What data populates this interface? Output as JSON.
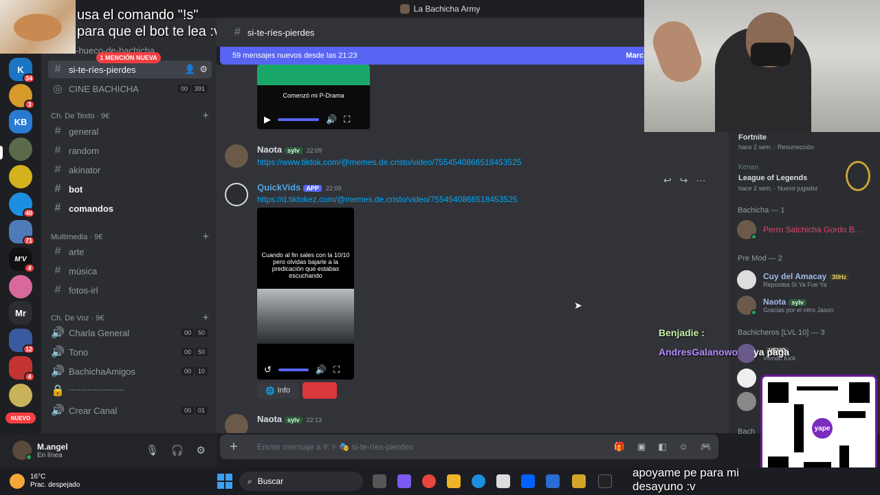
{
  "window": {
    "title": "La Bachicha Army"
  },
  "stream_overlay": {
    "top_left_text_1": "usa el comando \"!s\"",
    "top_left_text_2": "para que el bot te lea :v",
    "chat_user_1": "Benjadie :",
    "chat_user_2": "AndresGalanowo",
    "chat_msg_2": "ya paga",
    "bottom_text_1": "apoyame pe para mi",
    "bottom_text_2": "desayuno :v",
    "qr_logo": "yape"
  },
  "rail": {
    "badges": [
      "34",
      "3",
      "40",
      "71",
      "4",
      "12",
      "4"
    ],
    "server_labels": [
      "KB",
      "Mr"
    ],
    "new_label": "NUEVO"
  },
  "sidebar": {
    "server_name": "Bachicha Army",
    "mention_pill": "1 MENCIÓN NUEVA",
    "channels_top": [
      {
        "name": "el-hueco-de-bachicha"
      },
      {
        "name": "si-te-ríes-pierdes",
        "active": true
      },
      {
        "name": "CINE BACHICHA",
        "c1": "00",
        "c2": "391"
      }
    ],
    "cat_text": "Ch. De Texto · 9€",
    "text_channels": [
      "general",
      "random",
      "akinator",
      "bot",
      "comandos"
    ],
    "cat_media": "Multimedia · 9€",
    "media_channels": [
      "arte",
      "música",
      "fotos-irl"
    ],
    "cat_voice": "Ch. De Voz · 9€",
    "voice_channels": [
      {
        "name": "Charla General",
        "c1": "00",
        "c2": "50"
      },
      {
        "name": "Tono",
        "c1": "00",
        "c2": "50"
      },
      {
        "name": "BachichaAmigos",
        "c1": "00",
        "c2": "10"
      },
      {
        "name": "ᐧᐧᐧᐧᐧᐧᐧᐧᐧᐧᐧᐧᐧᐧᐧᐧᐧᐧᐧᐧᐧᐧᐧᐧ"
      },
      {
        "name": "Crear Canal",
        "c1": "00",
        "c2": "01"
      }
    ]
  },
  "user": {
    "name": "M.angel",
    "status": "En línea"
  },
  "header": {
    "channel": "si-te-ríes-pierdes"
  },
  "newbar": {
    "text": "59 mensajes nuevos desde las 21:23",
    "mark": "Marc"
  },
  "messages": {
    "video1_caption": "Comenzó mi P-Drama",
    "m1_author": "Naota",
    "m1_badge": "sylv",
    "m1_time": "22:09",
    "m1_link": "https://www.tiktok.com/@memes.de.cristo/video/7554540866518453525",
    "m2_author": "QuickVids",
    "m2_badge": "APP",
    "m2_time": "22:09",
    "m2_link": "https://d.tiktokez.com/@memes.de.cristo/video/7554540866518453525",
    "video2_caption": "Cuando al fin sales con la 10/10 pero olvidas bajarle a la predicación que estabas escuchando",
    "info_label": "Info",
    "m3_author": "Naota",
    "m3_badge": "sylv",
    "m3_time": "22:13"
  },
  "composer": {
    "placeholder": "Enviar mensaje a #: ⊧ 🎭 si-te-ríes-pierdes"
  },
  "members": {
    "act1_name": "Fortnite",
    "act1_sub": "hace 2 sem. · Resurrección",
    "act2_user": "Kenan",
    "act2_name": "League of Legends",
    "act2_sub": "hace 2 sem. · Nuevo jugador",
    "group1": "Bachicha — 1",
    "g1_member": "Perro Salchicha Gordo B...",
    "group2": "Pre Mod — 2",
    "g2_m1": "Cuy del Amacay",
    "g2_m1_badge": "30Hz",
    "g2_m1_sub": "Repostea Si Ya Fue Ya",
    "g2_m2": "Naota",
    "g2_m2_badge": "sylv",
    "g2_m2_sub": "Gracias por el nitro Jason",
    "group3": "Bachicheros [LVL 10] — 3",
    "g3_m1_badge": "VEVO",
    "g3_m1_sub": "Viendo Kick",
    "group4": "Bach"
  },
  "taskbar": {
    "temp": "16°C",
    "weather": "Prac. despejado",
    "search": "Buscar"
  },
  "colors": {
    "accent": "#5865f2",
    "mention": "#f23f43",
    "link": "#00a8fc",
    "online": "#23a55a"
  }
}
